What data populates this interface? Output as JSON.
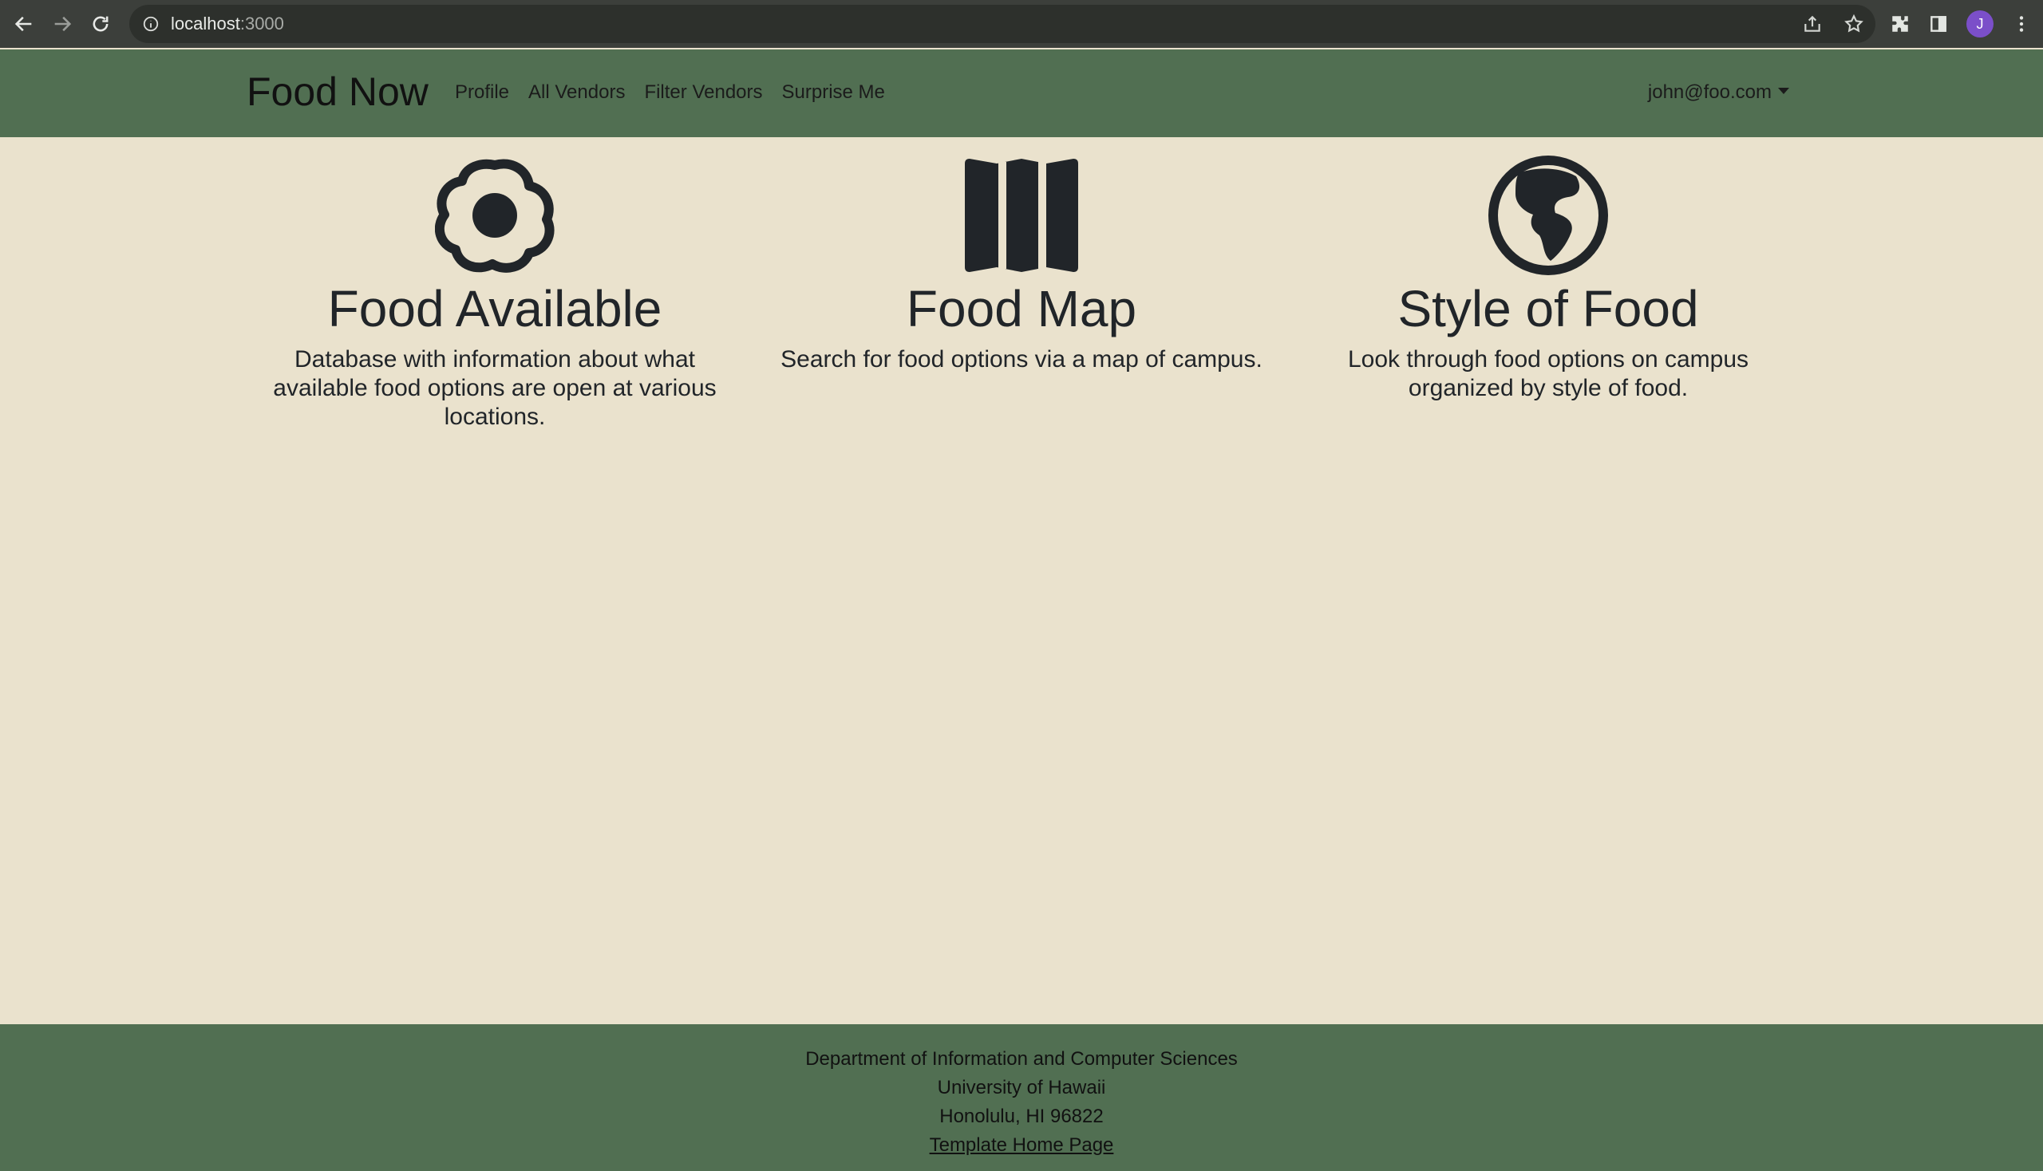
{
  "browser": {
    "url_host": "localhost",
    "url_port": ":3000",
    "avatar_letter": "J"
  },
  "navbar": {
    "brand": "Food Now",
    "links": [
      "Profile",
      "All Vendors",
      "Filter Vendors",
      "Surprise Me"
    ],
    "user": "john@foo.com"
  },
  "features": [
    {
      "icon": "egg-fried-icon",
      "title": "Food Available",
      "text": "Database with information about what available food options are open at various locations."
    },
    {
      "icon": "map-icon",
      "title": "Food Map",
      "text": "Search for food options via a map of campus."
    },
    {
      "icon": "globe-icon",
      "title": "Style of Food",
      "text": "Look through food options on campus organized by style of food."
    }
  ],
  "footer": {
    "line1": "Department of Information and Computer Sciences",
    "line2": "University of Hawaii",
    "line3": "Honolulu, HI 96822",
    "link": "Template Home Page"
  },
  "colors": {
    "navbar": "#516f52",
    "background": "#eae2cd",
    "text": "#212529"
  }
}
